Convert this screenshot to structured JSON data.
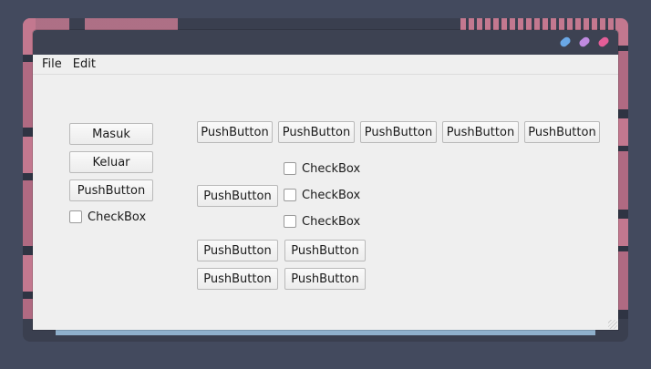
{
  "menu": {
    "file": "File",
    "edit": "Edit"
  },
  "controls": {
    "minimize_color": "#6aa8e6",
    "maximize_color": "#c08ae0",
    "close_color": "#e45e98"
  },
  "left": {
    "buttons": [
      "Masuk",
      "Keluar",
      "PushButton"
    ],
    "checkbox": "CheckBox"
  },
  "right": {
    "row_buttons": [
      "PushButton",
      "PushButton",
      "PushButton",
      "PushButton",
      "PushButton"
    ],
    "middle_button": "PushButton",
    "checkboxes": [
      "CheckBox",
      "CheckBox",
      "CheckBox"
    ],
    "grid_buttons": [
      "PushButton",
      "PushButton",
      "PushButton",
      "PushButton"
    ]
  }
}
